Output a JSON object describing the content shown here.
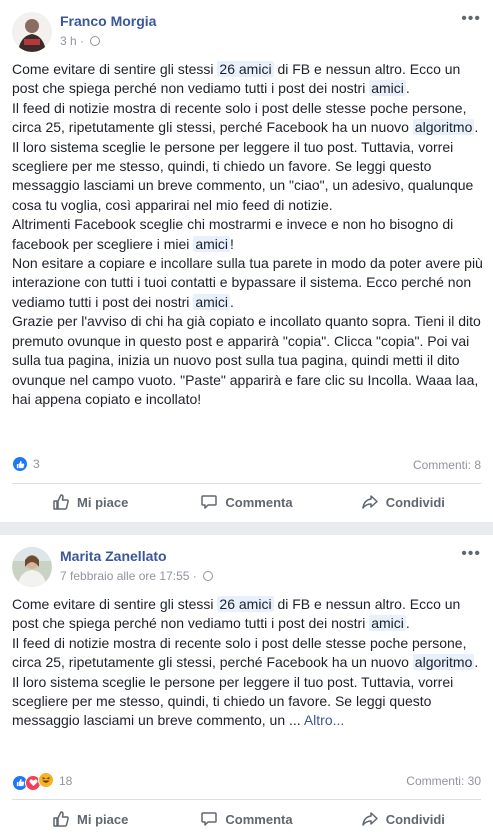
{
  "posts": [
    {
      "author": "Franco Morgia",
      "time": "3 h",
      "paragraphs": [
        [
          "Come evitare di sentire gli stessi ",
          {
            "hl": "26 amici"
          },
          " di FB e nessun altro. Ecco un post che spiega perché non vediamo tutti i post dei nostri ",
          {
            "hl": "amici"
          },
          "."
        ],
        [
          "Il feed di notizie mostra di recente solo i post delle stesse poche persone, circa 25, ripetutamente gli stessi, perché Facebook ha un nuovo ",
          {
            "hl": "algoritmo"
          },
          "."
        ],
        [
          "Il loro sistema sceglie le persone per leggere il tuo post. Tuttavia, vorrei scegliere per me stesso, quindi, ti chiedo un favore. Se leggi questo messaggio lasciami un breve commento, un \"ciao\", un adesivo, qualunque cosa tu voglia, così apparirai nel mio feed di notizie."
        ],
        [
          "Altrimenti Facebook sceglie chi mostrarmi e invece e non ho bisogno di facebook per scegliere i miei ",
          {
            "hl": "amici"
          },
          "!"
        ],
        [
          "Non esitare a copiare e incollare sulla tua parete in modo da poter avere più interazione con tutti i tuoi contatti e bypassare il sistema. Ecco perché non vediamo tutti i post dei nostri ",
          {
            "hl": "amici"
          },
          "."
        ],
        [
          "Grazie per l'avviso di chi ha già copiato e incollato quanto sopra. Tieni il dito premuto ovunque in questo post e apparirà \"copia\". Clicca \"copia\". Poi vai sulla tua pagina, inizia un nuovo post sulla tua pagina, quindi metti il dito ovunque nel campo vuoto. \"Paste\" apparirà e fare clic su Incolla. Waaa laa, hai appena copiato e incollato!"
        ]
      ],
      "reactions_count": "3",
      "reactions": [
        "like"
      ],
      "comments": "Commenti: 8"
    },
    {
      "author": "Marita Zanellato",
      "time": "7 febbraio alle ore 17:55",
      "paragraphs": [
        [
          "Come evitare di sentire gli stessi ",
          {
            "hl": "26 amici"
          },
          " di FB e nessun altro. Ecco un post che spiega perché non vediamo tutti i post dei nostri ",
          {
            "hl": "amici"
          },
          "."
        ],
        [
          "Il feed di notizie mostra di recente solo i post delle stesse poche persone, circa 25, ripetutamente gli stessi, perché Facebook ha un nuovo ",
          {
            "hl": "algoritmo"
          },
          "."
        ],
        [
          "Il loro sistema sceglie le persone per leggere il tuo post. Tuttavia, vorrei scegliere per me stesso, quindi, ti chiedo un favore. Se leggi questo messaggio lasciami un breve commento, un ... ",
          {
            "more": "Altro..."
          }
        ]
      ],
      "reactions_count": "18",
      "reactions": [
        "like",
        "love",
        "haha"
      ],
      "comments": "Commenti: 30"
    }
  ],
  "actions": {
    "like": "Mi piace",
    "comment": "Commenta",
    "share": "Condividi"
  },
  "more_menu": "•••",
  "colors": {
    "link": "#385898",
    "like": "#2078f4",
    "love": "#f33e58",
    "haha": "#f7b125"
  }
}
